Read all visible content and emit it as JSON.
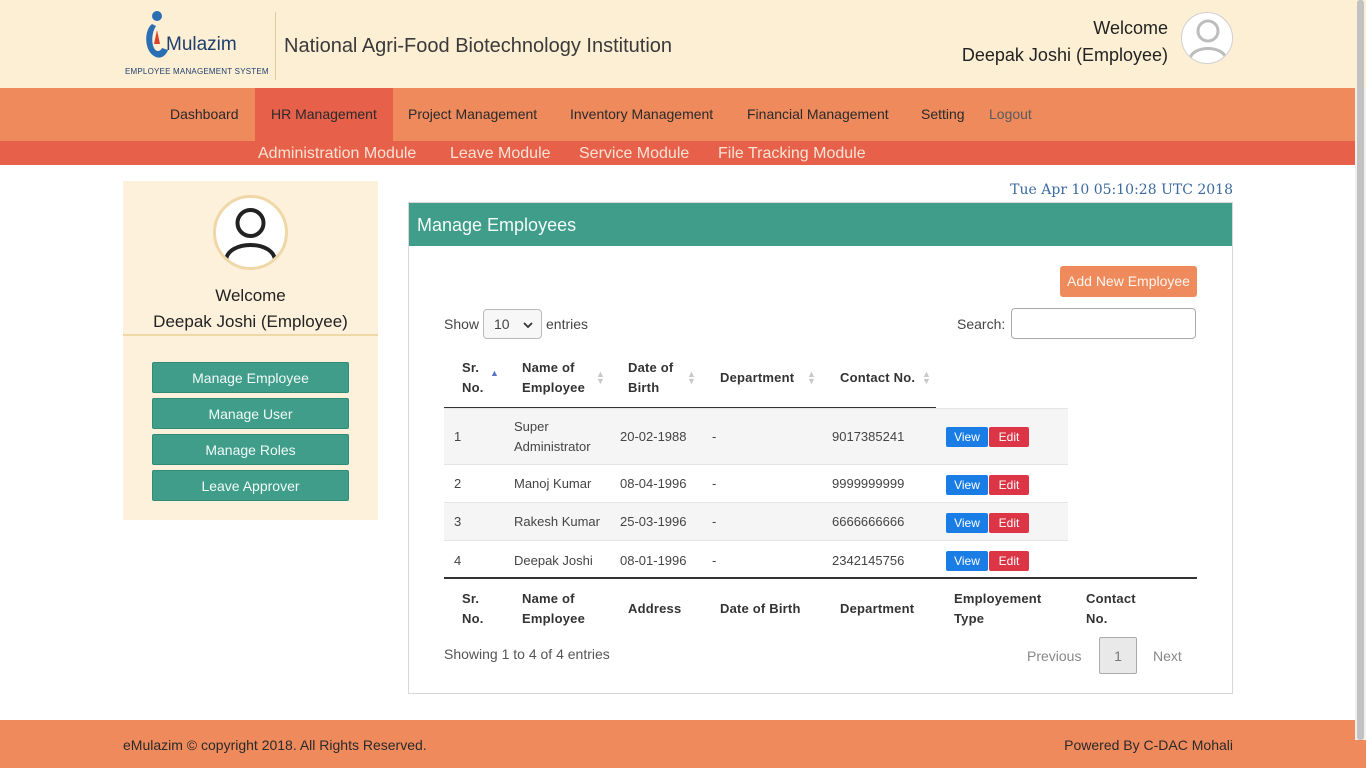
{
  "header": {
    "logo_word": "Mulazim",
    "logo_sub": "EMPLOYEE MANAGEMENT SYSTEM",
    "institution": "National Agri-Food Biotechnology Institution",
    "welcome": "Welcome",
    "user": "Deepak Joshi (Employee)"
  },
  "main_nav": {
    "items": [
      {
        "label": "Dashboard"
      },
      {
        "label": "HR Management"
      },
      {
        "label": "Project Management"
      },
      {
        "label": "Inventory Management"
      },
      {
        "label": "Financial Management"
      },
      {
        "label": "Setting"
      },
      {
        "label": "Logout"
      }
    ],
    "active": "HR Management"
  },
  "sub_nav": {
    "items": [
      {
        "label": "Administration Module"
      },
      {
        "label": "Leave Module"
      },
      {
        "label": "Service Module"
      },
      {
        "label": "File Tracking Module"
      }
    ]
  },
  "sidebar": {
    "welcome": "Welcome",
    "user": "Deepak Joshi (Employee)",
    "buttons": [
      {
        "label": "Manage Employee"
      },
      {
        "label": "Manage User"
      },
      {
        "label": "Manage Roles"
      },
      {
        "label": "Leave Approver"
      }
    ]
  },
  "datetime": "Tue Apr 10 05:10:28 UTC 2018",
  "panel": {
    "title": "Manage Employees",
    "add_button": "Add New Employee",
    "show_label": "Show",
    "show_value": "10",
    "entries_label": "entries",
    "search_label": "Search:",
    "search_value": "",
    "table": {
      "head": {
        "sr_1": "Sr.",
        "sr_2": "No.",
        "name_1": "Name of",
        "name_2": "Employee",
        "dob_1": "Date of",
        "dob_2": "Birth",
        "dept": "Department",
        "contact": "Contact No."
      },
      "rows": [
        {
          "sr": "1",
          "name_1": "Super",
          "name_2": "Administrator",
          "dob": "20-02-1988",
          "dept": "-",
          "contact": "9017385241",
          "view": "View",
          "edit": "Edit"
        },
        {
          "sr": "2",
          "name_1": "Manoj Kumar",
          "name_2": "",
          "dob": "08-04-1996",
          "dept": "-",
          "contact": "9999999999",
          "view": "View",
          "edit": "Edit"
        },
        {
          "sr": "3",
          "name_1": "Rakesh Kumar",
          "name_2": "",
          "dob": "25-03-1996",
          "dept": "-",
          "contact": "6666666666",
          "view": "View",
          "edit": "Edit"
        },
        {
          "sr": "4",
          "name_1": "Deepak Joshi",
          "name_2": "",
          "dob": "08-01-1996",
          "dept": "-",
          "contact": "2342145756",
          "view": "View",
          "edit": "Edit"
        }
      ],
      "foot": {
        "sr_1": "Sr.",
        "sr_2": "No.",
        "name_1": "Name of",
        "name_2": "Employee",
        "address": "Address",
        "dob": "Date of Birth",
        "dept": "Department",
        "type_1": "Employement",
        "type_2": "Type",
        "contact_1": "Contact",
        "contact_2": "No."
      }
    },
    "info": "Showing 1 to 4 of 4 entries",
    "pagination": {
      "previous": "Previous",
      "page": "1",
      "next": "Next"
    }
  },
  "footer": {
    "left": "eMulazim © copyright 2018. All Rights Reserved.",
    "right": "Powered By C-DAC Mohali"
  },
  "colors": {
    "header_bg": "#fdefd4",
    "nav_bg": "#ef8a5c",
    "subnav_bg": "#e6604a",
    "teal": "#3f9d8a",
    "view_blue": "#1a7de6",
    "edit_red": "#dc3545"
  }
}
